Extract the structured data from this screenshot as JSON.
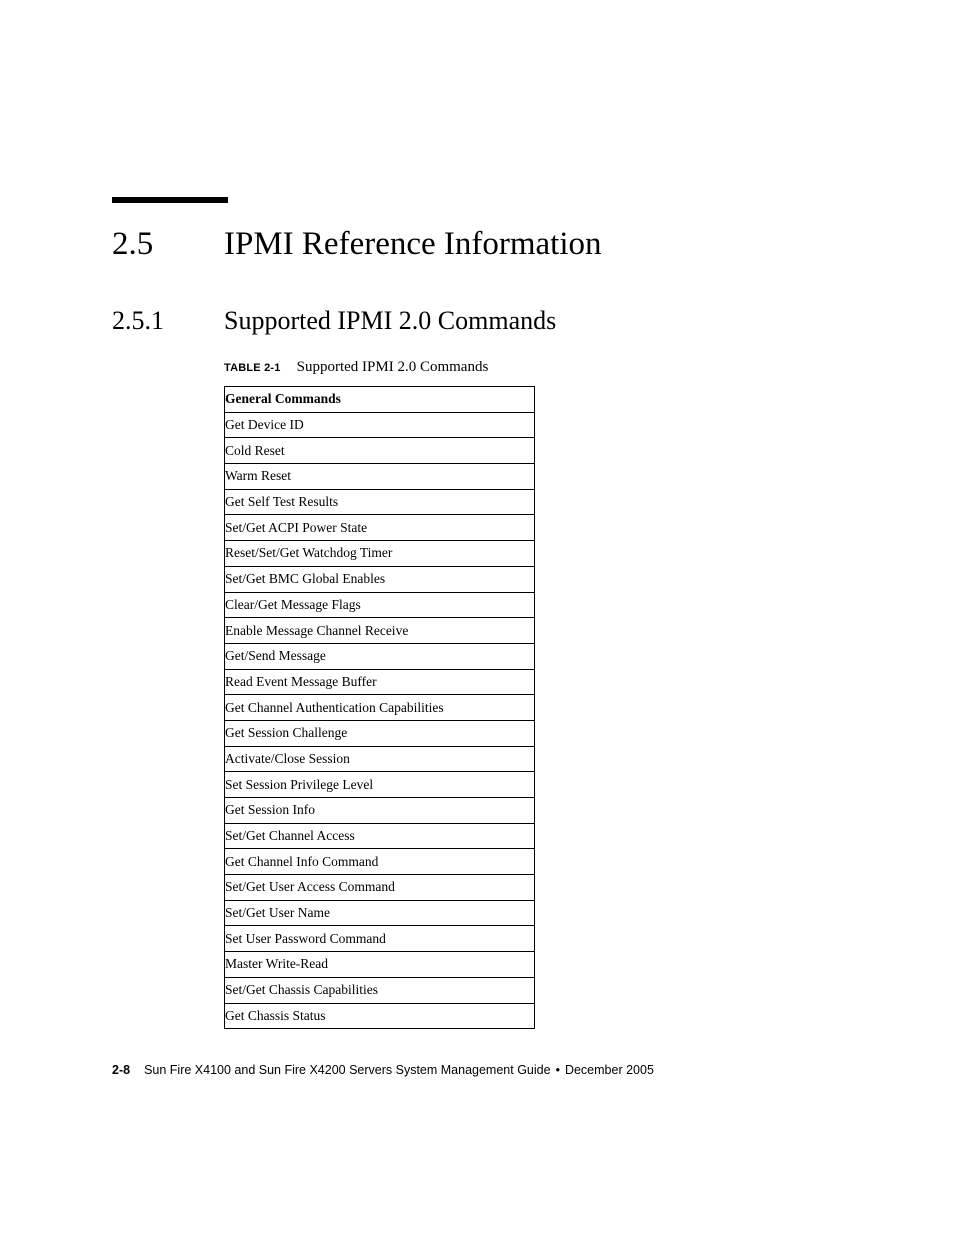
{
  "section": {
    "number": "2.5",
    "title": "IPMI Reference Information"
  },
  "subsection": {
    "number": "2.5.1",
    "title": "Supported IPMI 2.0 Commands"
  },
  "table": {
    "label": "TABLE 2-1",
    "caption": "Supported IPMI 2.0 Commands",
    "header": "General Commands",
    "rows": [
      "Get Device ID",
      "Cold Reset",
      "Warm Reset",
      "Get Self Test Results",
      "Set/Get ACPI Power State",
      "Reset/Set/Get Watchdog Timer",
      "Set/Get BMC Global Enables",
      "Clear/Get Message Flags",
      "Enable Message Channel Receive",
      "Get/Send Message",
      "Read Event Message Buffer",
      "Get Channel Authentication Capabilities",
      "Get Session Challenge",
      "Activate/Close Session",
      "Set Session Privilege Level",
      "Get Session Info",
      "Set/Get Channel Access",
      "Get Channel Info Command",
      "Set/Get User Access Command",
      "Set/Get User Name",
      "Set User Password Command",
      "Master Write-Read",
      "Set/Get Chassis Capabilities",
      "Get Chassis Status"
    ]
  },
  "footer": {
    "page_number": "2-8",
    "book_title": "Sun Fire X4100 and Sun Fire X4200 Servers System Management Guide",
    "separator": "•",
    "date": "December 2005"
  }
}
